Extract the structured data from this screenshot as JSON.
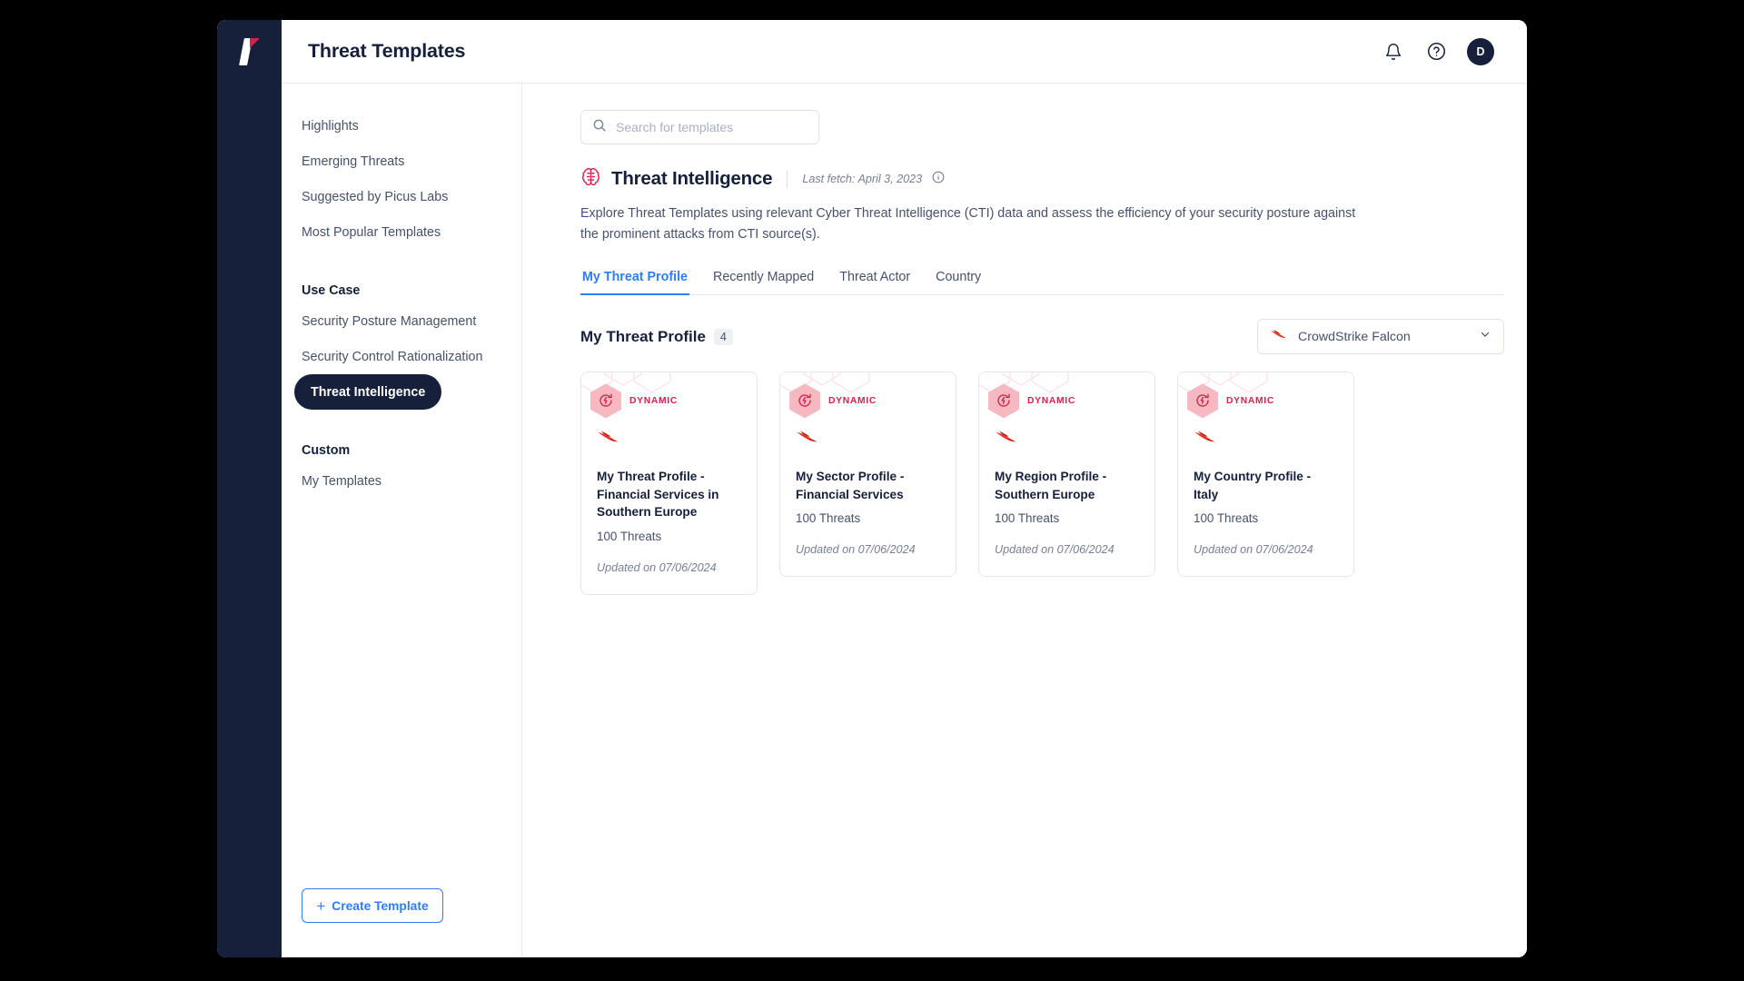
{
  "window": {
    "logo_name": "picus-logo",
    "colors": {
      "rail": "#16203a",
      "accent_blue": "#2f7cf6",
      "accent_crimson": "#d6224c",
      "badge_pink": "#f6b9c2",
      "text_dark": "#16203a",
      "text_muted": "#46516b"
    }
  },
  "topbar": {
    "title": "Threat Templates",
    "notifications_icon": "bell-icon",
    "help_icon": "help-circle-icon",
    "avatar_initial": "D"
  },
  "sidebar": {
    "items": [
      {
        "label": "Highlights",
        "active": false
      },
      {
        "label": "Emerging Threats",
        "active": false
      },
      {
        "label": "Suggested by Picus Labs",
        "active": false
      },
      {
        "label": "Most Popular Templates",
        "active": false
      }
    ],
    "use_case_label": "Use Case",
    "use_case_items": [
      {
        "label": "Security Posture Management",
        "active": false
      },
      {
        "label": "Security Control Rationalization",
        "active": false
      },
      {
        "label": "Threat Intelligence",
        "active": true
      }
    ],
    "custom_label": "Custom",
    "custom_items": [
      {
        "label": "My Templates",
        "active": false
      }
    ],
    "create_button": {
      "label": "Create Template",
      "plus": "+"
    }
  },
  "search": {
    "placeholder": "Search for templates",
    "value": "",
    "icon": "search-icon"
  },
  "threat_intelligence": {
    "icon": "brain-icon",
    "title": "Threat Intelligence",
    "last_fetch": "Last fetch: April 3, 2023",
    "info_icon": "info-circle-icon",
    "description": "Explore Threat Templates using relevant Cyber Threat Intelligence (CTI) data and assess the efficiency of your security posture against the prominent attacks from CTI source(s)."
  },
  "tabs": [
    {
      "label": "My Threat Profile",
      "active": true
    },
    {
      "label": "Recently Mapped",
      "active": false
    },
    {
      "label": "Threat Actor",
      "active": false
    },
    {
      "label": "Country",
      "active": false
    }
  ],
  "section": {
    "title": "My Threat Profile",
    "count": "4"
  },
  "source_select": {
    "label": "CrowdStrike Falcon",
    "logo_icon": "crowdstrike-falcon-icon",
    "chevron_icon": "chevron-down-icon"
  },
  "cards": [
    {
      "badge": "DYNAMIC",
      "badge_icon": "dynamic-refresh-icon",
      "vendor_icon": "crowdstrike-falcon-icon",
      "title": "My Threat Profile - Financial Services in Southern Europe",
      "threats": "100 Threats",
      "updated": "Updated on 07/06/2024"
    },
    {
      "badge": "DYNAMIC",
      "badge_icon": "dynamic-refresh-icon",
      "vendor_icon": "crowdstrike-falcon-icon",
      "title": "My Sector Profile - Financial Services",
      "threats": "100 Threats",
      "updated": "Updated on 07/06/2024"
    },
    {
      "badge": "DYNAMIC",
      "badge_icon": "dynamic-refresh-icon",
      "vendor_icon": "crowdstrike-falcon-icon",
      "title": "My Region Profile - Southern Europe",
      "threats": "100 Threats",
      "updated": "Updated on 07/06/2024"
    },
    {
      "badge": "DYNAMIC",
      "badge_icon": "dynamic-refresh-icon",
      "vendor_icon": "crowdstrike-falcon-icon",
      "title": "My Country Profile - Italy",
      "threats": "100 Threats",
      "updated": "Updated on 07/06/2024"
    }
  ]
}
